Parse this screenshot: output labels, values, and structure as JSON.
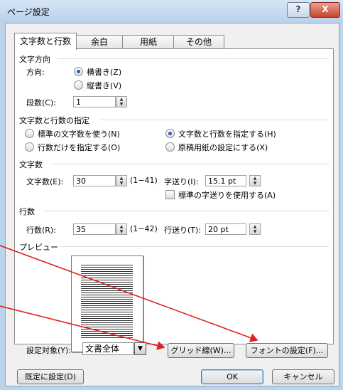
{
  "window": {
    "title": "ページ設定",
    "help_glyph": "?",
    "close_glyph": "X"
  },
  "tabs": [
    "文字数と行数",
    "余白",
    "用紙",
    "その他"
  ],
  "direction": {
    "group_label": "文字方向",
    "label": "方向:",
    "options": [
      "横書き(Z)",
      "縦書き(V)"
    ],
    "selected": 0,
    "columns_label": "段数(C):",
    "columns_value": "1"
  },
  "grid": {
    "group_label": "文字数と行数の指定",
    "options": [
      "標準の文字数を使う(N)",
      "文字数と行数を指定する(H)",
      "行数だけを指定する(O)",
      "原稿用紙の設定にする(X)"
    ],
    "selected": 1
  },
  "chars": {
    "group_label": "文字数",
    "label": "文字数(E):",
    "value": "30",
    "range": "(1−41)",
    "pitch_label": "字送り(I):",
    "pitch_value": "15.1 pt",
    "use_default_pitch": "標準の字送りを使用する(A)"
  },
  "lines": {
    "group_label": "行数",
    "label": "行数(R):",
    "value": "35",
    "range": "(1−42)",
    "pitch_label": "行送り(T):",
    "pitch_value": "20 pt"
  },
  "preview": {
    "group_label": "プレビュー"
  },
  "apply": {
    "label": "設定対象(Y):",
    "value": "文書全体",
    "grid_button": "グリッド線(W)...",
    "font_button": "フォントの設定(F)..."
  },
  "footer": {
    "default_button": "既定に設定(D)",
    "ok_button": "OK",
    "cancel_button": "キャンセル"
  },
  "annotation_color": "#e0201e"
}
